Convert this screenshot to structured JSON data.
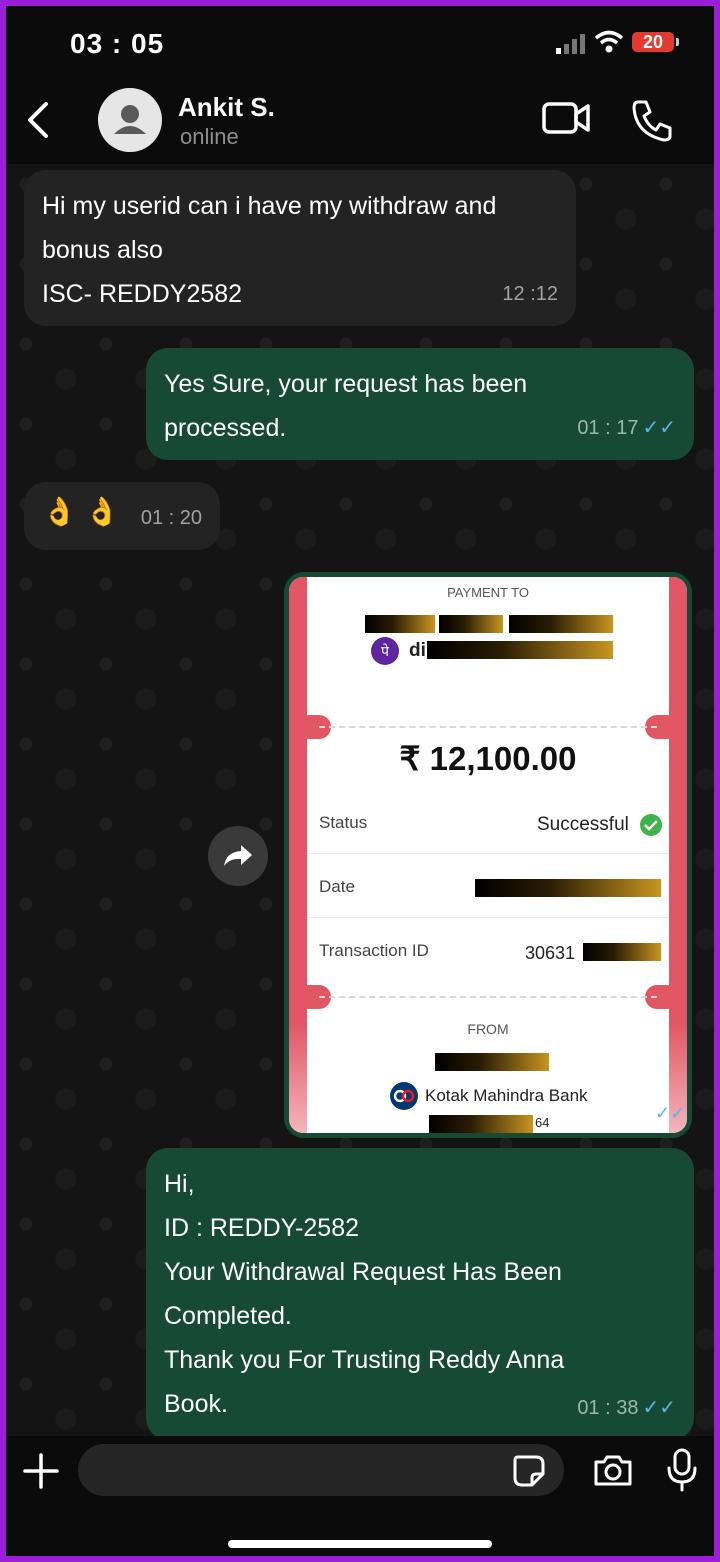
{
  "status_bar": {
    "time": "03 : 05",
    "battery": "20"
  },
  "contact": {
    "name": "Ankit S.",
    "presence": "online"
  },
  "messages": [
    {
      "lines": [
        "Hi my userid can i have my withdraw and",
        "bonus also",
        "ISC- REDDY2582"
      ],
      "time": "12 :12",
      "direction": "in"
    },
    {
      "lines": [
        "Yes Sure, your request has been",
        "processed."
      ],
      "time": "01 : 17",
      "direction": "out"
    },
    {
      "emoji": "👌 👌",
      "time": "01 : 20",
      "direction": "in"
    },
    {
      "lines": [
        "Hi,",
        "ID : REDDY-2582",
        "Your Withdrawal Request Has Been",
        "Completed.",
        "Thank you For Trusting Reddy Anna",
        "Book."
      ],
      "time": "01 : 38",
      "direction": "out"
    }
  ],
  "receipt": {
    "payment_to_label": "PAYMENT TO",
    "payee_prefix": "di",
    "amount": "₹ 12,100.00",
    "status_label": "Status",
    "status_value": "Successful",
    "date_label": "Date",
    "txn_label": "Transaction ID",
    "txn_value_prefix": "30631",
    "from_label": "FROM",
    "bank_name": "Kotak Mahindra Bank",
    "account_suffix": "64",
    "app_glyph": "पे"
  },
  "icons": [
    "back-icon",
    "avatar-icon",
    "video-call-icon",
    "phone-call-icon",
    "forward-icon",
    "plus-icon",
    "sticker-icon",
    "camera-icon",
    "mic-icon",
    "read-receipt-icon"
  ],
  "colors": {
    "incoming_bubble": "#232323",
    "outgoing_bubble": "#164a35",
    "read_ticks": "#5bb5f0",
    "receipt_accent": "#e25562",
    "success": "#3cb44a"
  }
}
